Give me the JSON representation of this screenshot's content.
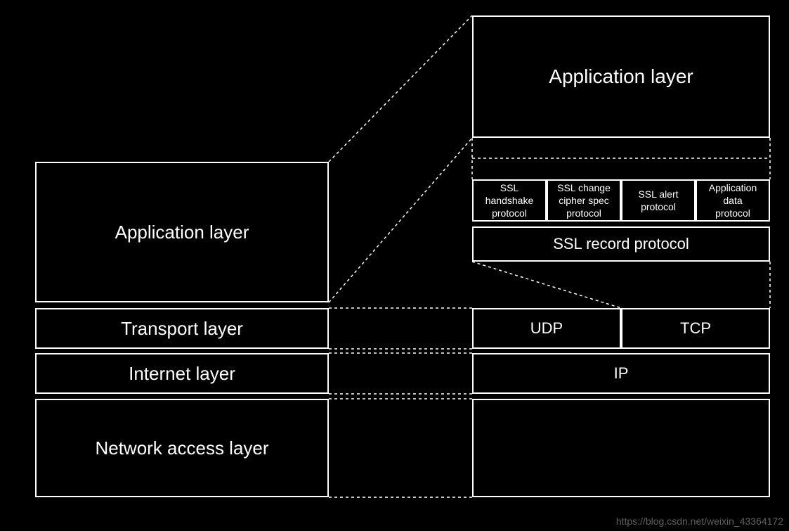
{
  "left_stack": {
    "application": "Application layer",
    "transport": "Transport layer",
    "internet": "Internet layer",
    "network_access": "Network access layer"
  },
  "right_detail": {
    "application": "Application layer",
    "ssl_sub": [
      "SSL\nhandshake\nprotocol",
      "SSL change\ncipher spec\nprotocol",
      "SSL alert\nprotocol",
      "Application\ndata\nprotocol"
    ],
    "ssl_record": "SSL record protocol",
    "udp": "UDP",
    "tcp": "TCP",
    "ip": "IP"
  },
  "watermark": "https://blog.csdn.net/weixin_43364172"
}
